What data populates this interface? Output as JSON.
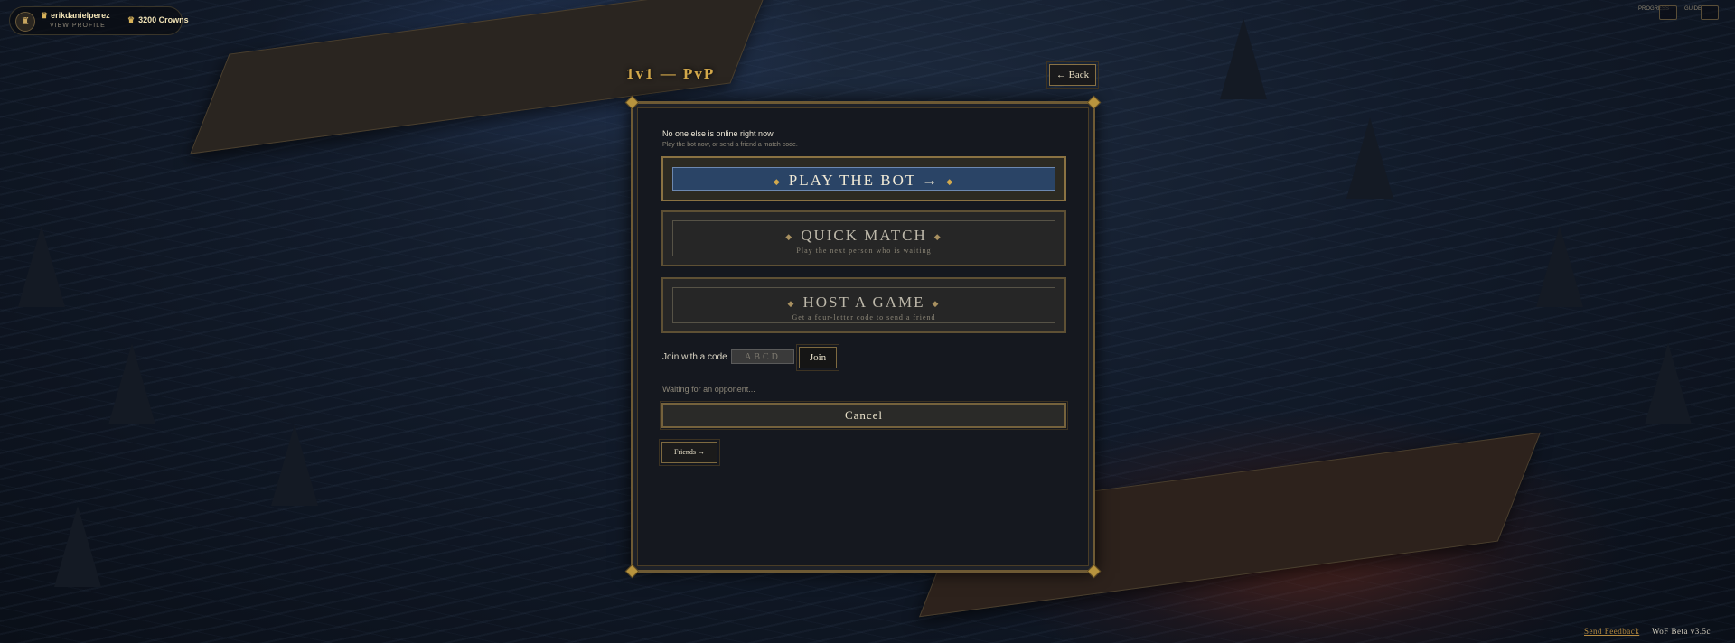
{
  "profile": {
    "username": "erikdanielperez",
    "view_profile": "VIEW PROFILE",
    "crowns": "3200 Crowns"
  },
  "top_right": {
    "labels": [
      "PROGRESS",
      "GUIDE"
    ]
  },
  "header": {
    "title": "1v1 — PvP",
    "back_label": "← Back"
  },
  "panel": {
    "online_title": "No one else is online right now",
    "online_subtitle": "Play the bot now, or send a friend a match code.",
    "options": [
      {
        "label": "PLAY THE BOT →",
        "subtitle": ""
      },
      {
        "label": "QUICK MATCH",
        "subtitle": "Play the next person who is waiting"
      },
      {
        "label": "HOST A GAME",
        "subtitle": "Get a four-letter code to send a friend"
      }
    ],
    "join": {
      "label": "Join with a code",
      "placeholder": "ABCD",
      "button": "Join"
    },
    "waiting_text": "Waiting for an opponent...",
    "cancel_label": "Cancel",
    "friends_label": "Friends →"
  },
  "footer": {
    "feedback": "Send Feedback",
    "version": "WoF Beta v3.5c"
  },
  "colors": {
    "gold": "#d3a84a",
    "panel_bg": "#15181f",
    "play_bot_blue": "#2a4466"
  },
  "icons": [
    "crown-icon",
    "avatar-icon",
    "diamond-icon"
  ]
}
